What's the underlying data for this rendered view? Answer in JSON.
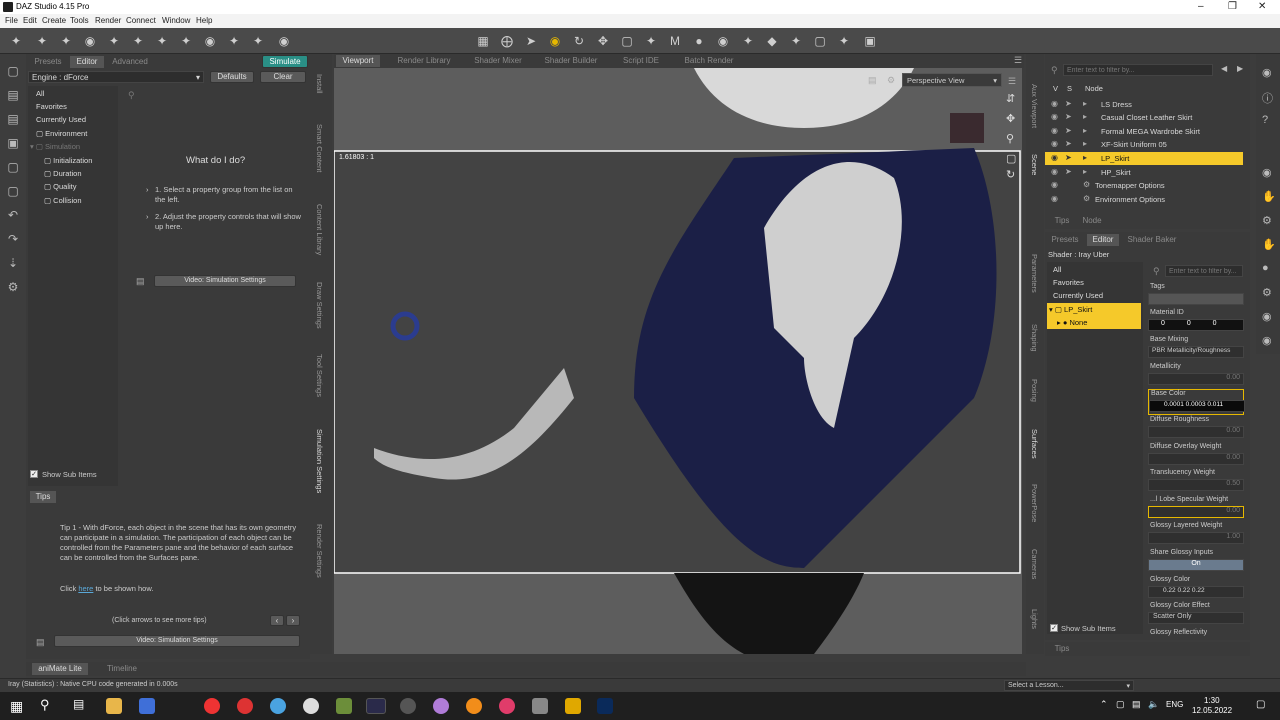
{
  "window": {
    "title": "DAZ Studio 4.15 Pro"
  },
  "menu": [
    "File",
    "Edit",
    "Create",
    "Tools",
    "Render",
    "Connect",
    "Window",
    "Help"
  ],
  "left_pane": {
    "tabs": [
      "Presets",
      "Editor",
      "Advanced"
    ],
    "simulate_label": "Simulate",
    "engine_label": "Engine : dForce",
    "defaults_label": "Defaults",
    "clear_label": "Clear",
    "tree": [
      "All",
      "Favorites",
      "Currently Used",
      "Environment",
      "Simulation",
      "Initialization",
      "Duration",
      "Quality",
      "Collision"
    ],
    "help_title": "What do I do?",
    "help_step1": "1. Select a property group from the list on the left.",
    "help_step2": "2. Adjust the property controls that will show up here.",
    "video_label": "Video: Simulation Settings",
    "show_sub_items": "Show Sub Items"
  },
  "tips": {
    "title": "Tips",
    "text": "Tip 1 - With dForce, each object in the scene that has its own geometry can participate in a simulation. The participation of each object can be controlled from the Parameters pane and the behavior of each surface can be controlled from the Surfaces pane.",
    "click_prefix": "Click ",
    "link": "here",
    "click_suffix": " to be shown how.",
    "arrows_hint": "(Click arrows to see more tips)",
    "video_label": "Video: Simulation Settings"
  },
  "left_vtabs": [
    "Install",
    "Smart Content",
    "Content Library",
    "Draw Settings",
    "Tool Settings",
    "Simulation Settings",
    "Render Settings"
  ],
  "viewport": {
    "tabs": [
      "Viewport",
      "Render Library",
      "Shader Mixer",
      "Shader Builder",
      "Script IDE",
      "Batch Render"
    ],
    "perspective_label": "Perspective View",
    "ratio_label": "1.61803 : 1"
  },
  "scene": {
    "search_placeholder": "Enter text to filter by...",
    "col_v": "V",
    "col_s": "S",
    "col_node": "Node",
    "nodes": [
      "LS Dress",
      "Casual Closet Leather Skirt",
      "Formal MEGA Wardrobe Skirt",
      "XF-Skirt Uniform 05",
      "LP_Skirt",
      "HP_Skirt",
      "Tonemapper Options",
      "Environment Options"
    ],
    "tabs": [
      "Tips",
      "Node"
    ]
  },
  "right_vtabs": [
    "Aux Viewport",
    "Scene",
    "Parameters",
    "Shaping",
    "Posing",
    "Surfaces",
    "PowerPose",
    "Cameras",
    "Lights"
  ],
  "surfaces": {
    "tabs": [
      "Presets",
      "Editor",
      "Shader Baker"
    ],
    "shader_label": "Shader : Iray Uber",
    "tree": [
      "All",
      "Favorites",
      "Currently Used",
      "LP_Skirt",
      "None"
    ],
    "search_placeholder": "Enter text to filter by...",
    "props": [
      {
        "name": "Tags",
        "value": ""
      },
      {
        "name": "Material ID",
        "value": "0   0   0"
      },
      {
        "name": "Base Mixing",
        "value": "PBR Metallicity/Roughness"
      },
      {
        "name": "Metallicity",
        "value": "0.00"
      },
      {
        "name": "Base Color",
        "value": "0.0001  0.0003  0.011"
      },
      {
        "name": "Diffuse Roughness",
        "value": "0.00"
      },
      {
        "name": "Diffuse Overlay Weight",
        "value": "0.00"
      },
      {
        "name": "Translucency Weight",
        "value": "0.50"
      },
      {
        "name": "...l Lobe Specular Weight",
        "value": "0.00"
      },
      {
        "name": "Glossy Layered Weight",
        "value": "1.00"
      },
      {
        "name": "Share Glossy Inputs",
        "value": "On"
      },
      {
        "name": "Glossy Color",
        "value": "0.22  0.22  0.22"
      },
      {
        "name": "Glossy Color Effect",
        "value": "Scatter Only"
      },
      {
        "name": "Glossy Reflectivity",
        "value": ""
      }
    ],
    "show_sub_items": "Show Sub Items",
    "tips_tab": "Tips"
  },
  "bottom_tabs": [
    "aniMate Lite",
    "Timeline"
  ],
  "status": {
    "text": "Iray (Statistics) : Native CPU code generated in 0.000s",
    "lesson_placeholder": "Select a Lesson..."
  },
  "taskbar": {
    "lang": "ENG",
    "time": "1:30",
    "date": "12.05.2022"
  }
}
